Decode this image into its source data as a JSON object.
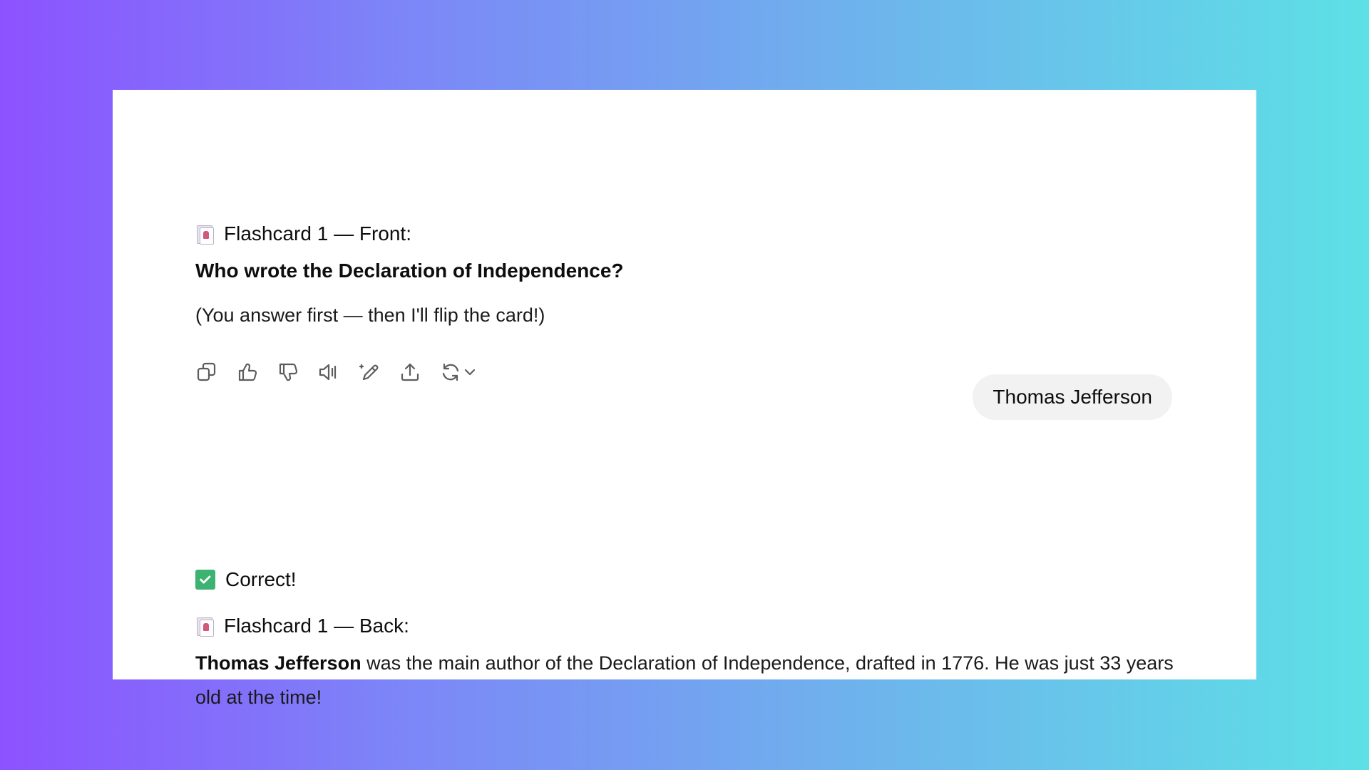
{
  "front": {
    "heading": "Flashcard 1 — Front:",
    "question": "Who wrote the Declaration of Independence?",
    "hint": "(You answer first — then I'll flip the card!)",
    "icon": "flashcard-emoji-icon"
  },
  "toolbar": {
    "items": [
      {
        "name": "copy-icon"
      },
      {
        "name": "thumbs-up-icon"
      },
      {
        "name": "thumbs-down-icon"
      },
      {
        "name": "read-aloud-icon"
      },
      {
        "name": "edit-icon"
      },
      {
        "name": "share-icon"
      },
      {
        "name": "regenerate-icon"
      }
    ]
  },
  "user_message": {
    "text": "Thomas Jefferson"
  },
  "result": {
    "status": "Correct!",
    "icon": "check-mark-icon",
    "status_color": "#3cb371"
  },
  "back": {
    "heading": "Flashcard 1 — Back:",
    "answer_strong": "Thomas Jefferson",
    "answer_rest": " was the main author of the Declaration of Independence, drafted in 1776. He was just 33 years old at the time!"
  }
}
